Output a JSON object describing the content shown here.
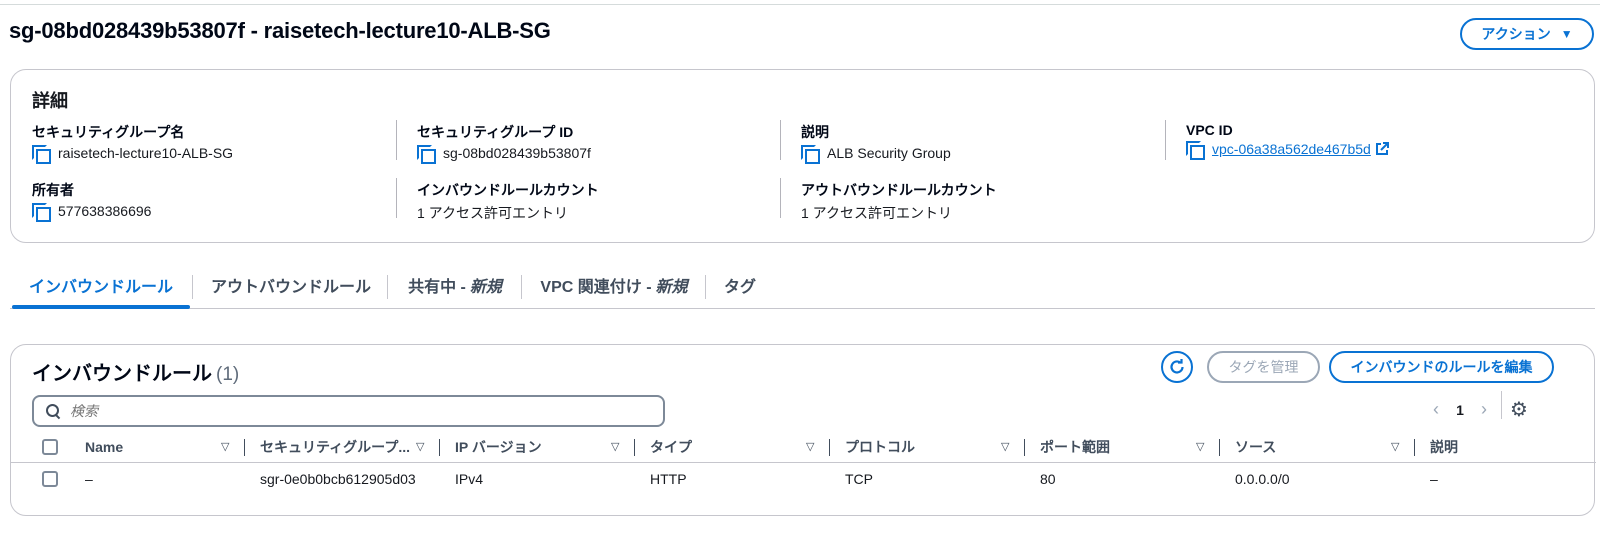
{
  "header": {
    "title": "sg-08bd028439b53807f - raisetech-lecture10-ALB-SG",
    "action_label": "アクション"
  },
  "details": {
    "heading": "詳細",
    "fields": [
      {
        "label": "セキュリティグループ名",
        "value": "raisetech-lecture10-ALB-SG",
        "copy": true
      },
      {
        "label": "セキュリティグループ ID",
        "value": "sg-08bd028439b53807f",
        "copy": true
      },
      {
        "label": "説明",
        "value": "ALB Security Group",
        "copy": true
      },
      {
        "label": "VPC ID",
        "value": "vpc-06a38a562de467b5d",
        "copy": true,
        "link": true
      },
      {
        "label": "所有者",
        "value": "577638386696",
        "copy": true
      },
      {
        "label": "インバウンドルールカウント",
        "value": "1 アクセス許可エントリ"
      },
      {
        "label": "アウトバウンドルールカウント",
        "value": "1 アクセス許可エントリ"
      }
    ]
  },
  "tabs": [
    {
      "label": "インバウンドルール",
      "active": true
    },
    {
      "label": "アウトバウンドルール"
    },
    {
      "label": "共有中 -",
      "badge": "新規"
    },
    {
      "label": "VPC 関連付け -",
      "badge": "新規"
    },
    {
      "label": "タグ"
    }
  ],
  "rules": {
    "title": "インバウンドルール",
    "count": "(1)",
    "manage_tags_label": "タグを管理",
    "edit_label": "インバウンドのルールを編集",
    "search_placeholder": "検索",
    "page": "1",
    "columns": [
      "Name",
      "セキュリティグループ...",
      "IP バージョン",
      "タイプ",
      "プロトコル",
      "ポート範囲",
      "ソース",
      "説明"
    ],
    "rows": [
      {
        "name": "–",
        "sgr_id": "sgr-0e0b0bcb612905d03",
        "ip_version": "IPv4",
        "type": "HTTP",
        "protocol": "TCP",
        "port_range": "80",
        "source": "0.0.0.0/0",
        "description": "–"
      }
    ]
  },
  "colors": {
    "accent": "#0972d3",
    "text": "#16191f",
    "border": "#c6c6cd",
    "disabled": "#9ba7b6"
  }
}
